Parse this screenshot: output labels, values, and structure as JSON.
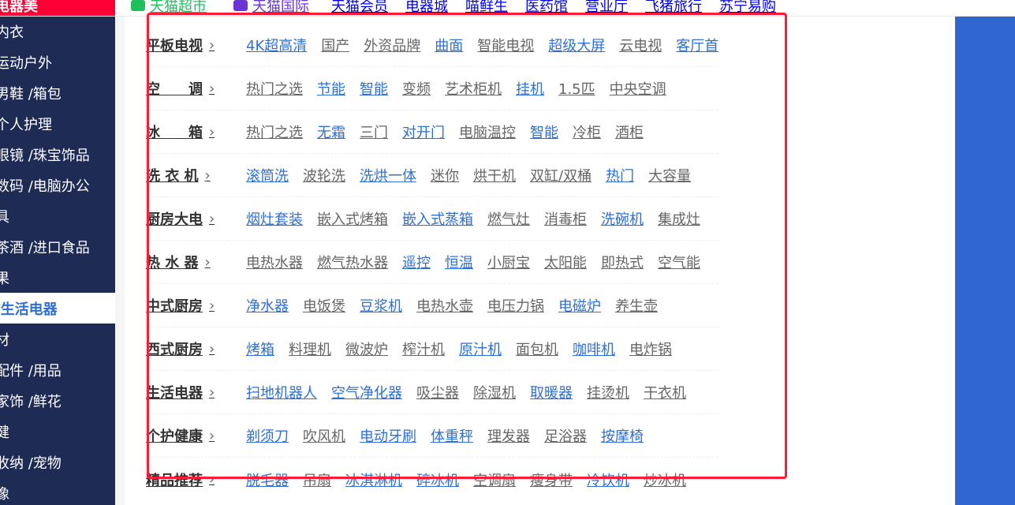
{
  "topbar": {
    "left_label": "电器美",
    "links": [
      {
        "label": "天猫超市",
        "style": "green"
      },
      {
        "label": "天猫国际",
        "style": "purple"
      },
      {
        "label": "天猫会员",
        "style": "normal"
      },
      {
        "label": "电器城",
        "style": "normal"
      },
      {
        "label": "喵鲜生",
        "style": "normal"
      },
      {
        "label": "医药馆",
        "style": "normal"
      },
      {
        "label": "营业厅",
        "style": "normal"
      },
      {
        "label": "飞猪旅行",
        "style": "normal"
      },
      {
        "label": "苏宁易购",
        "style": "normal"
      }
    ]
  },
  "sidebar": {
    "items": [
      {
        "label": "内衣",
        "active": false
      },
      {
        "label": "运动户外",
        "active": false
      },
      {
        "label": "男鞋 /箱包",
        "active": false
      },
      {
        "label": "个人护理",
        "active": false
      },
      {
        "label": "眼镜 /珠宝饰品",
        "active": false
      },
      {
        "label": "数码 /电脑办公",
        "active": false
      },
      {
        "label": "具",
        "active": false
      },
      {
        "label": "茶酒 /进口食品",
        "active": false
      },
      {
        "label": "果",
        "active": false
      },
      {
        "label": "/生活电器",
        "active": true
      },
      {
        "label": "材",
        "active": false
      },
      {
        "label": "配件 /用品",
        "active": false
      },
      {
        "label": "家饰 /鲜花",
        "active": false
      },
      {
        "label": "健",
        "active": false
      },
      {
        "label": "收纳 /宠物",
        "active": false
      },
      {
        "label": "像",
        "active": false
      }
    ]
  },
  "panel": {
    "rows": [
      {
        "category": "平板电视",
        "links": [
          {
            "label": "4K超高清",
            "highlight": true
          },
          {
            "label": "国产",
            "highlight": false
          },
          {
            "label": "外资品牌",
            "highlight": false
          },
          {
            "label": "曲面",
            "highlight": true
          },
          {
            "label": "智能电视",
            "highlight": false
          },
          {
            "label": "超级大屏",
            "highlight": true
          },
          {
            "label": "云电视",
            "highlight": false
          },
          {
            "label": "客厅首选",
            "highlight": true
          }
        ]
      },
      {
        "category": "空　　调",
        "links": [
          {
            "label": "热门之选",
            "highlight": false
          },
          {
            "label": "节能",
            "highlight": true
          },
          {
            "label": "智能",
            "highlight": true
          },
          {
            "label": "变频",
            "highlight": false
          },
          {
            "label": "艺术柜机",
            "highlight": false
          },
          {
            "label": "挂机",
            "highlight": true
          },
          {
            "label": "1.5匹",
            "highlight": false
          },
          {
            "label": "中央空调",
            "highlight": false
          }
        ]
      },
      {
        "category": "冰　　箱",
        "links": [
          {
            "label": "热门之选",
            "highlight": false
          },
          {
            "label": "无霜",
            "highlight": true
          },
          {
            "label": "三门",
            "highlight": false
          },
          {
            "label": "对开门",
            "highlight": true
          },
          {
            "label": "电脑温控",
            "highlight": false
          },
          {
            "label": "智能",
            "highlight": true
          },
          {
            "label": "冷柜",
            "highlight": false
          },
          {
            "label": "酒柜",
            "highlight": false
          }
        ]
      },
      {
        "category": "洗 衣 机",
        "links": [
          {
            "label": "滚筒洗",
            "highlight": true
          },
          {
            "label": "波轮洗",
            "highlight": false
          },
          {
            "label": "洗烘一体",
            "highlight": true
          },
          {
            "label": "迷你",
            "highlight": false
          },
          {
            "label": "烘干机",
            "highlight": false
          },
          {
            "label": "双缸/双桶",
            "highlight": false
          },
          {
            "label": "热门",
            "highlight": true
          },
          {
            "label": "大容量",
            "highlight": false
          }
        ]
      },
      {
        "category": "厨房大电",
        "links": [
          {
            "label": "烟灶套装",
            "highlight": true
          },
          {
            "label": "嵌入式烤箱",
            "highlight": false
          },
          {
            "label": "嵌入式蒸箱",
            "highlight": true
          },
          {
            "label": "燃气灶",
            "highlight": false
          },
          {
            "label": "消毒柜",
            "highlight": false
          },
          {
            "label": "洗碗机",
            "highlight": true
          },
          {
            "label": "集成灶",
            "highlight": false
          }
        ]
      },
      {
        "category": "热 水 器",
        "links": [
          {
            "label": "电热水器",
            "highlight": false
          },
          {
            "label": "燃气热水器",
            "highlight": false
          },
          {
            "label": "遥控",
            "highlight": true
          },
          {
            "label": "恒温",
            "highlight": true
          },
          {
            "label": "小厨宝",
            "highlight": false
          },
          {
            "label": "太阳能",
            "highlight": false
          },
          {
            "label": "即热式",
            "highlight": false
          },
          {
            "label": "空气能",
            "highlight": false
          }
        ]
      },
      {
        "category": "中式厨房",
        "links": [
          {
            "label": "净水器",
            "highlight": true
          },
          {
            "label": "电饭煲",
            "highlight": false
          },
          {
            "label": "豆浆机",
            "highlight": true
          },
          {
            "label": "电热水壶",
            "highlight": false
          },
          {
            "label": "电压力锅",
            "highlight": false
          },
          {
            "label": "电磁炉",
            "highlight": true
          },
          {
            "label": "养生壶",
            "highlight": false
          }
        ]
      },
      {
        "category": "西式厨房",
        "links": [
          {
            "label": "烤箱",
            "highlight": true
          },
          {
            "label": "料理机",
            "highlight": false
          },
          {
            "label": "微波炉",
            "highlight": false
          },
          {
            "label": "榨汁机",
            "highlight": false
          },
          {
            "label": "原汁机",
            "highlight": true
          },
          {
            "label": "面包机",
            "highlight": false
          },
          {
            "label": "咖啡机",
            "highlight": true
          },
          {
            "label": "电炸锅",
            "highlight": false
          }
        ]
      },
      {
        "category": "生活电器",
        "links": [
          {
            "label": "扫地机器人",
            "highlight": true
          },
          {
            "label": "空气净化器",
            "highlight": true
          },
          {
            "label": "吸尘器",
            "highlight": false
          },
          {
            "label": "除湿机",
            "highlight": false
          },
          {
            "label": "取暖器",
            "highlight": true
          },
          {
            "label": "挂烫机",
            "highlight": false
          },
          {
            "label": "干衣机",
            "highlight": false
          }
        ]
      },
      {
        "category": "个护健康",
        "links": [
          {
            "label": "剃须刀",
            "highlight": true
          },
          {
            "label": "吹风机",
            "highlight": false
          },
          {
            "label": "电动牙刷",
            "highlight": true
          },
          {
            "label": "体重秤",
            "highlight": true
          },
          {
            "label": "理发器",
            "highlight": false
          },
          {
            "label": "足浴器",
            "highlight": false
          },
          {
            "label": "按摩椅",
            "highlight": true
          }
        ]
      },
      {
        "category": "精品推荐",
        "links": [
          {
            "label": "脱毛器",
            "highlight": true
          },
          {
            "label": "吊扇",
            "highlight": false
          },
          {
            "label": "冰淇淋机",
            "highlight": true
          },
          {
            "label": "碎冰机",
            "highlight": true
          },
          {
            "label": "空调扇",
            "highlight": false
          },
          {
            "label": "瘦身带",
            "highlight": false
          },
          {
            "label": "冷饮机",
            "highlight": true
          },
          {
            "label": "炒冰机",
            "highlight": false
          }
        ]
      }
    ]
  },
  "colors": {
    "sidebar_bg": "#1d2b55",
    "accent_red": "#ff0036",
    "highlight_border": "#ff1a36",
    "link_blue": "#2f6fd3",
    "right_blue": "#2f66d0"
  }
}
